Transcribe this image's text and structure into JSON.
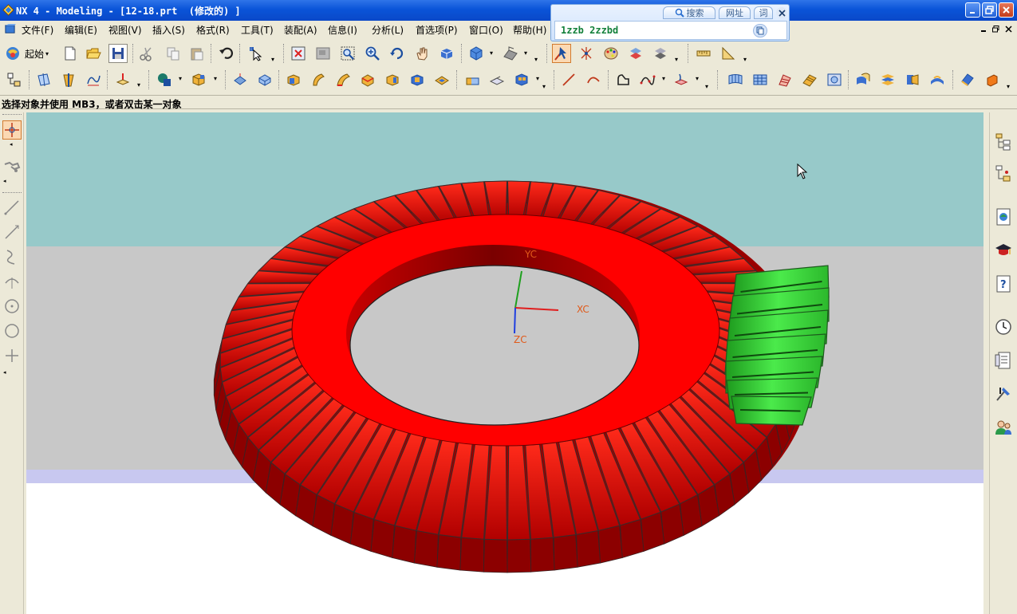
{
  "window": {
    "title": "NX 4 - Modeling - [12-18.prt  (修改的) ]"
  },
  "menu": {
    "items": [
      {
        "label": "文件(F)"
      },
      {
        "label": "编辑(E)"
      },
      {
        "label": "视图(V)"
      },
      {
        "label": "插入(S)"
      },
      {
        "label": "格式(R)"
      },
      {
        "label": "工具(T)"
      },
      {
        "label": "装配(A)"
      },
      {
        "label": "信息(I)"
      },
      {
        "label": "分析(L)"
      },
      {
        "label": "首选项(P)"
      },
      {
        "label": "窗口(O)"
      },
      {
        "label": "帮助(H)"
      }
    ]
  },
  "search_popup": {
    "tabs": [
      "搜索",
      "网址",
      "词"
    ],
    "value": "1zzb 2zzbd"
  },
  "toolbar": {
    "start_label": "起始"
  },
  "status": {
    "cue": "选择对象并使用 MB3，或者双击某一对象"
  },
  "viewport": {
    "axes": {
      "x": "XC",
      "y": "YC",
      "z": "ZC"
    },
    "colors": {
      "background_top": "#97c9c9",
      "background_mid": "#c8c8c8",
      "ring_gear": "#ff0000",
      "pinion_gear": "#33cc33"
    }
  }
}
